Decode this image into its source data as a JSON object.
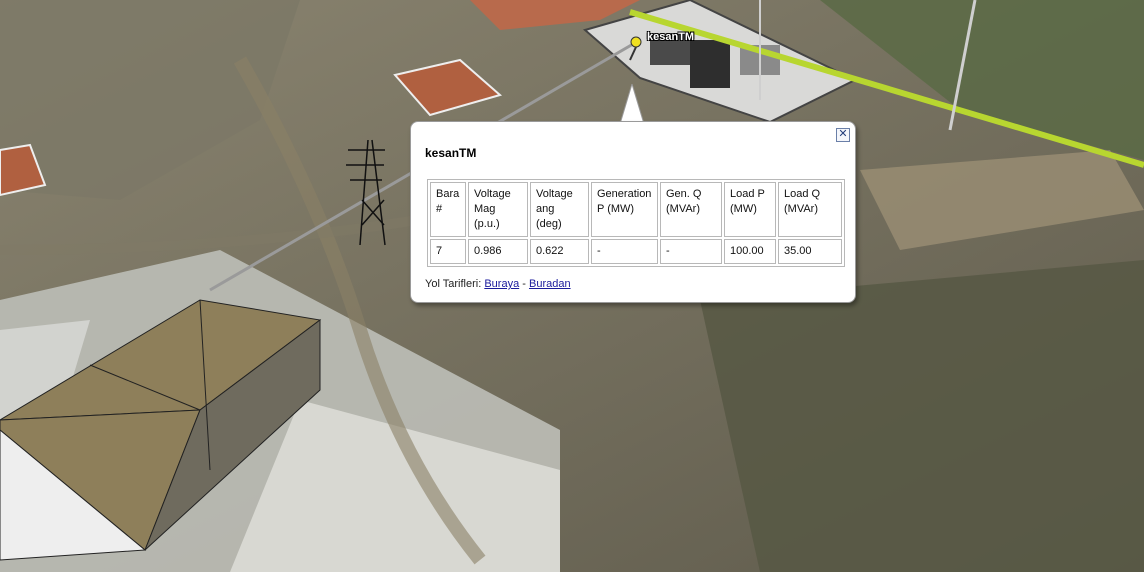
{
  "map": {
    "placemark_label": "kesanTM",
    "colors": {
      "ground": "#6b6758",
      "transmission_line": "#b8d630",
      "building_roof": "#8e7f5a",
      "building_wall": "#6f6b5e"
    }
  },
  "balloon": {
    "title": "kesanTM",
    "close_icon": "close-icon",
    "table": {
      "headers": [
        "Bara #",
        "Voltage Mag (p.u.)",
        "Voltage ang (deg)",
        "Generation P (MW)",
        "Gen. Q (MVAr)",
        "Load P (MW)",
        "Load Q (MVAr)"
      ],
      "rows": [
        [
          "7",
          "0.986",
          "0.622",
          "-",
          "-",
          "100.00",
          "35.00"
        ]
      ]
    },
    "directions": {
      "label": "Yol Tarifleri:",
      "to_here": "Buraya",
      "separator": "-",
      "from_here": "Buradan"
    }
  }
}
